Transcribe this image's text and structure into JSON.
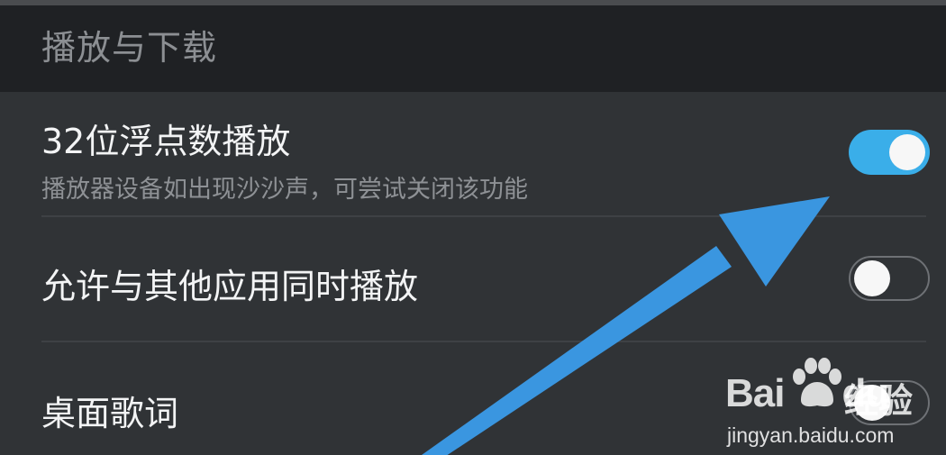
{
  "section": {
    "title": "播放与下载"
  },
  "settings": [
    {
      "title": "32位浮点数播放",
      "subtitle": "播放器设备如出现沙沙声，可尝试关闭该功能",
      "enabled": true
    },
    {
      "title": "允许与其他应用同时播放",
      "enabled": false
    },
    {
      "title": "桌面歌词",
      "enabled": false
    }
  ],
  "colors": {
    "background": "#303336",
    "header_background": "#1f2124",
    "toggle_on": "#3aaee9",
    "annotation_arrow": "#3a96e0"
  },
  "watermark": {
    "brand_left": "Bai",
    "brand_right": "du",
    "suffix": "经验",
    "url": "jingyan.baidu.com"
  }
}
